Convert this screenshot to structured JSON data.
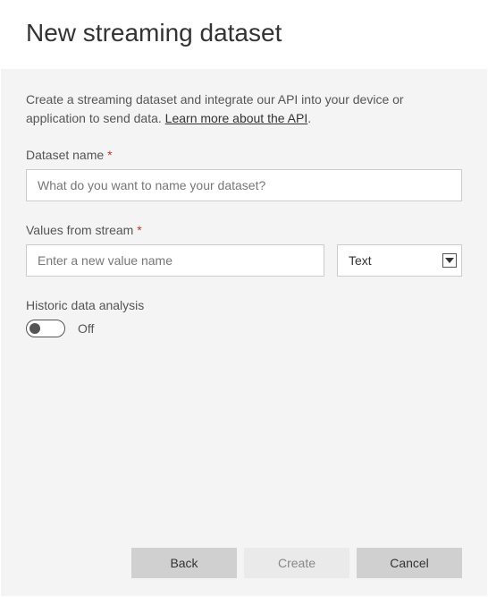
{
  "header": {
    "title": "New streaming dataset"
  },
  "description": {
    "text_before_link": "Create a streaming dataset and integrate our API into your device or application to send data. ",
    "link_text": "Learn more about the API",
    "text_after_link": "."
  },
  "fields": {
    "dataset_name": {
      "label": "Dataset name",
      "required_mark": "*",
      "placeholder": "What do you want to name your dataset?"
    },
    "values_stream": {
      "label": "Values from stream",
      "required_mark": "*",
      "value_name_placeholder": "Enter a new value name",
      "type_selected": "Text"
    },
    "historic": {
      "label": "Historic data analysis",
      "state_label": "Off"
    }
  },
  "footer": {
    "back": "Back",
    "create": "Create",
    "cancel": "Cancel"
  }
}
